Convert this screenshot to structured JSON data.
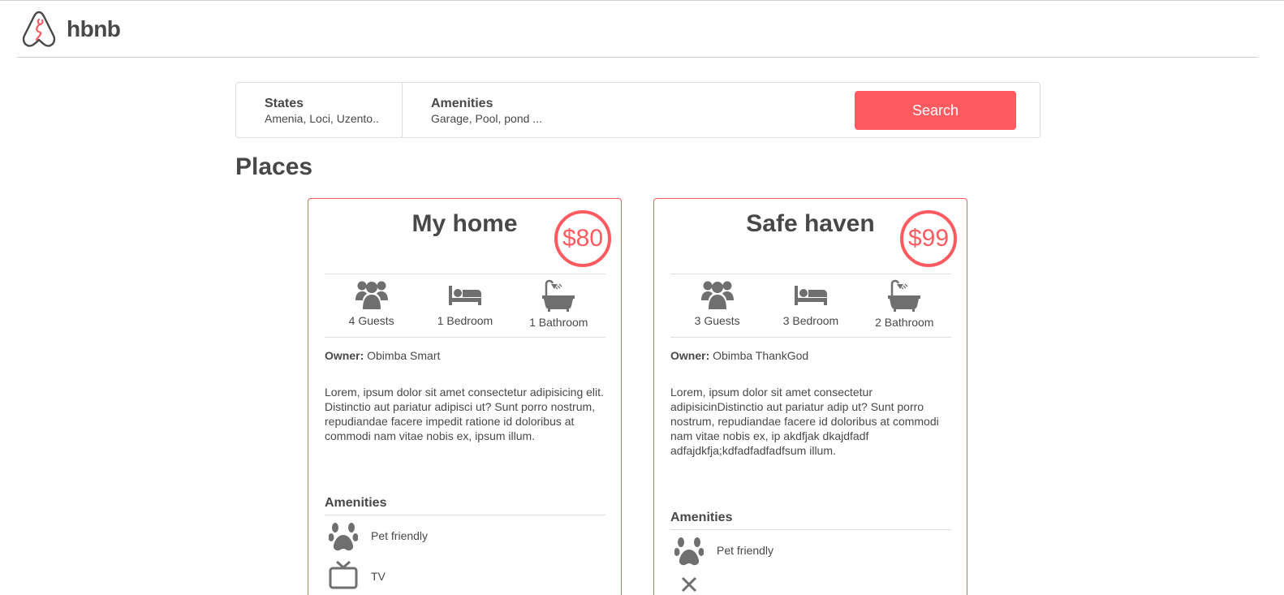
{
  "header": {
    "logo_text": "hbnb"
  },
  "filters": {
    "states_title": "States",
    "states_value": "Amenia, Loci, Uzento..",
    "amenities_title": "Amenities",
    "amenities_value": "Garage, Pool, pond ...",
    "search_label": "Search"
  },
  "places_title": "Places",
  "places": [
    {
      "name": "My home",
      "price": "$80",
      "guests": "4 Guests",
      "bedrooms": "1 Bedroom",
      "bathrooms": "1 Bathroom",
      "owner_label": "Owner:",
      "owner_name": "Obimba Smart",
      "description": "Lorem, ipsum dolor sit amet consectetur adipisicing elit. Distinctio aut pariatur adipisci ut? Sunt porro nostrum, repudiandae facere impedit ratione id doloribus at commodi nam vitae nobis ex, ipsum illum.",
      "amenities_title": "Amenities",
      "amenities": [
        {
          "label": "Pet friendly",
          "icon": "paw-icon"
        },
        {
          "label": "TV",
          "icon": "tv-icon"
        }
      ]
    },
    {
      "name": "Safe haven",
      "price": "$99",
      "guests": "3 Guests",
      "bedrooms": "3 Bedroom",
      "bathrooms": "2 Bathroom",
      "owner_label": "Owner:",
      "owner_name": "Obimba ThankGod",
      "description": "Lorem, ipsum dolor sit amet consectetur adipisicinDistinctio aut pariatur adip ut? Sunt porro nostrum, repudiandae facere id doloribus at commodi nam vitae nobis ex, ip akdfjak dkajdfadf adfajdkfja;kdfadfadfadfsum illum.",
      "amenities_title": "Amenities",
      "amenities": [
        {
          "label": "Pet friendly",
          "icon": "paw-icon"
        }
      ]
    }
  ],
  "colors": {
    "accent": "#ff5a5f",
    "text": "#484848",
    "icon": "#6f6f6f",
    "border": "#dddddd"
  }
}
